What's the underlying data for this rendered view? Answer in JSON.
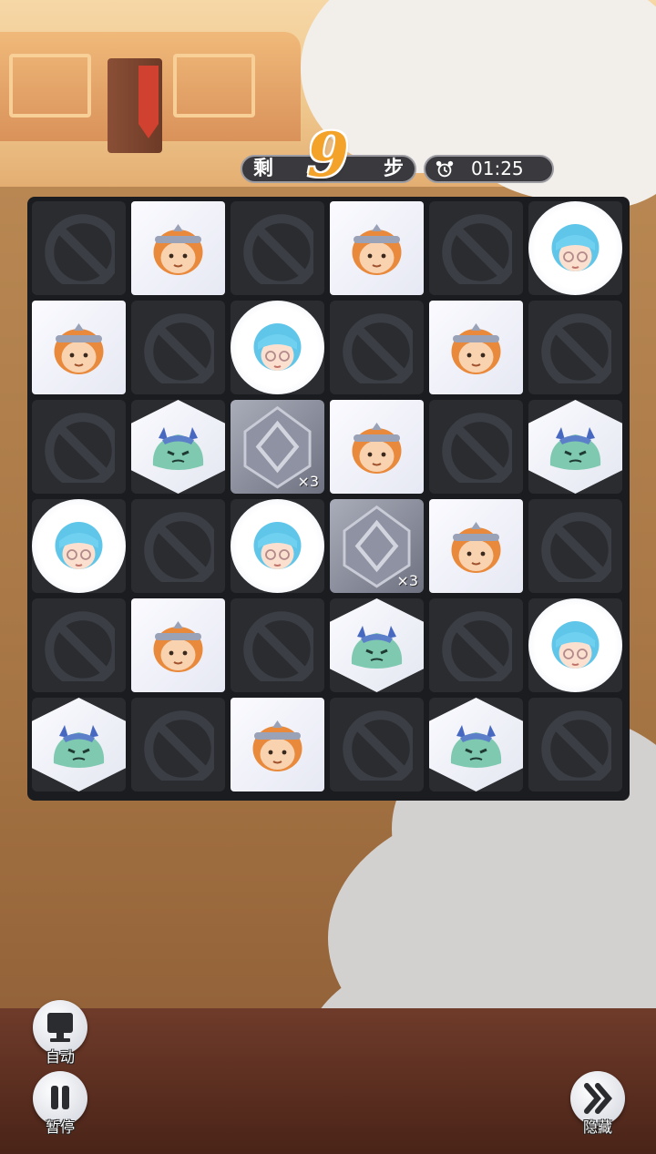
{
  "hud": {
    "steps_prefix": "剩",
    "steps_value": "9",
    "steps_suffix": "步",
    "timer_icon": "alarm-clock-icon",
    "timer": "01:25"
  },
  "board": {
    "rows": 6,
    "cols": 6,
    "cells": [
      [
        "blocked",
        "monkey",
        "blocked",
        "monkey",
        "blocked",
        "girl"
      ],
      [
        "monkey",
        "blocked",
        "girl",
        "blocked",
        "monkey",
        "blocked"
      ],
      [
        "blocked",
        "slime",
        "stone",
        "monkey",
        "blocked",
        "slime"
      ],
      [
        "girl",
        "blocked",
        "girl",
        "stone",
        "monkey",
        "blocked"
      ],
      [
        "blocked",
        "monkey",
        "blocked",
        "slime",
        "blocked",
        "girl"
      ],
      [
        "slime",
        "blocked",
        "monkey",
        "blocked",
        "slime",
        "blocked"
      ]
    ],
    "stone_multiplier": "×3",
    "piece_names": {
      "blocked": "blocked-cell-icon",
      "monkey": "monkey-king-head-icon",
      "girl": "blue-hair-girl-head-icon",
      "slime": "green-slime-monster-icon",
      "stone": "stone-crystal-block-icon"
    }
  },
  "controls": {
    "auto_label": "自动",
    "auto_icon": "monitor-icon",
    "pause_label": "暂停",
    "pause_icon": "pause-icon",
    "hide_label": "隐藏",
    "hide_icon": "double-chevron-right-icon"
  }
}
